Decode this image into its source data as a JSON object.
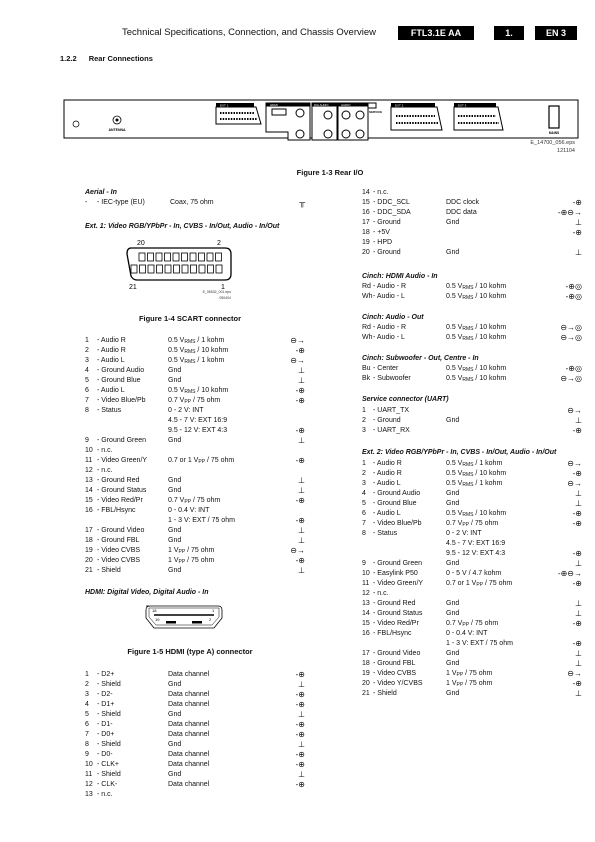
{
  "header": {
    "title": "Technical Specifications, Connection, and Chassis Overview",
    "model": "FTL3.1E AA",
    "chapter": "1.",
    "page": "EN 3"
  },
  "section": {
    "number": "1.2.2",
    "title": "Rear Connections"
  },
  "rear_panel": {
    "labels": {
      "antenna": "ANTENNA",
      "ext1": "EXT 1",
      "hdmi": "HDMI",
      "digital_audio": "DIG AUDIO",
      "audio": "AUDIO",
      "service": "SERVICE",
      "ext2": "EXT 2",
      "ext3": "EXT 3",
      "mains": "MAINS"
    },
    "file": "E_14700_056.eps",
    "date": "121104",
    "caption": "Figure 1-3 Rear I/O"
  },
  "icons": {
    "in": "in-arrow-icon",
    "out": "out-arrow-icon",
    "gnd": "ground-icon",
    "inout": "in-out-icon",
    "in-cinch": "in-cinch-icon",
    "out-cinch": "out-cinch-icon"
  },
  "aerial": {
    "heading": "Aerial - In",
    "rows": [
      {
        "n": "-",
        "name": "- IEC-type (EU)",
        "value": "Coax, 75 ohm",
        "icon": "aerial"
      }
    ]
  },
  "ext1": {
    "heading": "Ext. 1: Video RGB/YPbPr - In, CVBS - In/Out, Audio - In/Out",
    "figure": {
      "pin_tl": "20",
      "pin_tr": "2",
      "pin_bl": "21",
      "pin_br": "1",
      "file": "E_06532_001.eps",
      "date": "050404",
      "caption": "Figure 1-4 SCART connector"
    },
    "rows": [
      {
        "n": "1",
        "name": "- Audio R",
        "value": [
          "0.5 V",
          "RMS",
          " / 1 kohm"
        ],
        "icon": "out"
      },
      {
        "n": "2",
        "name": "- Audio R",
        "value": [
          "0.5 V",
          "RMS",
          " / 10 kohm"
        ],
        "icon": "in"
      },
      {
        "n": "3",
        "name": "- Audio L",
        "value": [
          "0.5 V",
          "RMS",
          " / 1 kohm"
        ],
        "icon": "out"
      },
      {
        "n": "4",
        "name": "- Ground Audio",
        "value": "Gnd",
        "icon": "gnd"
      },
      {
        "n": "5",
        "name": "- Ground Blue",
        "value": "Gnd",
        "icon": "gnd"
      },
      {
        "n": "6",
        "name": "- Audio L",
        "value": [
          "0.5 V",
          "RMS",
          " / 10 kohm"
        ],
        "icon": "in"
      },
      {
        "n": "7",
        "name": "- Video Blue/Pb",
        "value": [
          "0.7 V",
          "PP",
          " / 75 ohm"
        ],
        "icon": "in"
      },
      {
        "n": "8",
        "name": "- Status",
        "value": "0 - 2 V: INT",
        "icon": ""
      },
      {
        "n": "",
        "name": "",
        "value": "4.5 - 7 V: EXT 16:9",
        "icon": ""
      },
      {
        "n": "",
        "name": "",
        "value": "9.5 - 12 V: EXT 4:3",
        "icon": "in"
      },
      {
        "n": "9",
        "name": "- Ground Green",
        "value": "Gnd",
        "icon": "gnd"
      },
      {
        "n": "10",
        "name": "- n.c.",
        "value": "",
        "icon": ""
      },
      {
        "n": "11",
        "name": "- Video Green/Y",
        "value": [
          "0.7 or 1 V",
          "PP",
          " / 75 ohm"
        ],
        "icon": "in"
      },
      {
        "n": "12",
        "name": "- n.c.",
        "value": "",
        "icon": ""
      },
      {
        "n": "13",
        "name": "- Ground Red",
        "value": "Gnd",
        "icon": "gnd"
      },
      {
        "n": "14",
        "name": "- Ground Status",
        "value": "Gnd",
        "icon": "gnd"
      },
      {
        "n": "15",
        "name": "- Video Red/Pr",
        "value": [
          "0.7 V",
          "PP",
          " / 75 ohm"
        ],
        "icon": "in"
      },
      {
        "n": "16",
        "name": "- FBL/Hsync",
        "value": "0 - 0.4 V: INT",
        "icon": ""
      },
      {
        "n": "",
        "name": "",
        "value": "1 - 3 V: EXT / 75 ohm",
        "icon": "in"
      },
      {
        "n": "17",
        "name": "- Ground Video",
        "value": "Gnd",
        "icon": "gnd"
      },
      {
        "n": "18",
        "name": "- Ground FBL",
        "value": "Gnd",
        "icon": "gnd"
      },
      {
        "n": "19",
        "name": "- Video CVBS",
        "value": [
          "1 V",
          "PP",
          " / 75 ohm"
        ],
        "icon": "out"
      },
      {
        "n": "20",
        "name": "- Video CVBS",
        "value": [
          "1 V",
          "PP",
          " / 75 ohm"
        ],
        "icon": "in"
      },
      {
        "n": "21",
        "name": "- Shield",
        "value": "Gnd",
        "icon": "gnd"
      }
    ]
  },
  "hdmi": {
    "heading": "HDMI: Digital Video, Digital Audio - In",
    "figure": {
      "pin_tl": "18",
      "pin_tr": "1",
      "pin_bl": "19",
      "pin_br": "2",
      "caption": "Figure 1-5 HDMI (type A) connector"
    },
    "rows": [
      {
        "n": "1",
        "name": "- D2+",
        "value": "Data channel",
        "icon": "in"
      },
      {
        "n": "2",
        "name": "- Shield",
        "value": "Gnd",
        "icon": "gnd"
      },
      {
        "n": "3",
        "name": "- D2-",
        "value": "Data channel",
        "icon": "in"
      },
      {
        "n": "4",
        "name": "- D1+",
        "value": "Data channel",
        "icon": "in"
      },
      {
        "n": "5",
        "name": "- Shield",
        "value": "Gnd",
        "icon": "gnd"
      },
      {
        "n": "6",
        "name": "- D1-",
        "value": "Data channel",
        "icon": "in"
      },
      {
        "n": "7",
        "name": "- D0+",
        "value": "Data channel",
        "icon": "in"
      },
      {
        "n": "8",
        "name": "- Shield",
        "value": "Gnd",
        "icon": "gnd"
      },
      {
        "n": "9",
        "name": "- D0-",
        "value": "Data channel",
        "icon": "in"
      },
      {
        "n": "10",
        "name": "- CLK+",
        "value": "Data channel",
        "icon": "in"
      },
      {
        "n": "11",
        "name": "- Shield",
        "value": "Gnd",
        "icon": "gnd"
      },
      {
        "n": "12",
        "name": "- CLK-",
        "value": "Data channel",
        "icon": "in"
      },
      {
        "n": "13",
        "name": "- n.c.",
        "value": "",
        "icon": ""
      }
    ],
    "rows_cont": [
      {
        "n": "14",
        "name": "- n.c.",
        "value": "",
        "icon": ""
      },
      {
        "n": "15",
        "name": "- DDC_SCL",
        "value": "DDC clock",
        "icon": "in"
      },
      {
        "n": "16",
        "name": "- DDC_SDA",
        "value": "DDC data",
        "icon": "inout"
      },
      {
        "n": "17",
        "name": "- Ground",
        "value": "Gnd",
        "icon": "gnd"
      },
      {
        "n": "18",
        "name": "- +5V",
        "value": "",
        "icon": "in"
      },
      {
        "n": "19",
        "name": "- HPD",
        "value": "",
        "icon": ""
      },
      {
        "n": "20",
        "name": "- Ground",
        "value": "Gnd",
        "icon": "gnd"
      }
    ]
  },
  "cinch_hdmi_audio": {
    "heading": "Cinch: HDMI Audio - In",
    "rows": [
      {
        "n": "Rd",
        "name": "- Audio - R",
        "value": [
          "0.5 V",
          "RMS",
          " / 10 kohm"
        ],
        "icon": "in-cinch"
      },
      {
        "n": "Wh",
        "name": "- Audio - L",
        "value": [
          "0.5 V",
          "RMS",
          " / 10 kohm"
        ],
        "icon": "in-cinch"
      }
    ]
  },
  "cinch_audio_out": {
    "heading": "Cinch: Audio - Out",
    "rows": [
      {
        "n": "Rd",
        "name": "- Audio - R",
        "value": [
          "0.5 V",
          "RMS",
          " / 10 kohm"
        ],
        "icon": "out-cinch"
      },
      {
        "n": "Wh",
        "name": "- Audio - L",
        "value": [
          "0.5 V",
          "RMS",
          " / 10 kohm"
        ],
        "icon": "out-cinch"
      }
    ]
  },
  "cinch_sub": {
    "heading": "Cinch: Subwoofer - Out, Centre - In",
    "rows": [
      {
        "n": "Bu",
        "name": "- Center",
        "value": [
          "0.5 V",
          "RMS",
          " / 10 kohm"
        ],
        "icon": "in-cinch"
      },
      {
        "n": "Bk",
        "name": "- Subwoofer",
        "value": [
          "0.5 V",
          "RMS",
          " / 10 kohm"
        ],
        "icon": "out-cinch"
      }
    ]
  },
  "service": {
    "heading": "Service connector (UART)",
    "rows": [
      {
        "n": "1",
        "name": "- UART_TX",
        "value": "",
        "icon": "out"
      },
      {
        "n": "2",
        "name": "- Ground",
        "value": "Gnd",
        "icon": "gnd"
      },
      {
        "n": "3",
        "name": "- UART_RX",
        "value": "",
        "icon": "in"
      }
    ]
  },
  "ext2": {
    "heading": "Ext. 2: Video RGB/YPbPr - In, CVBS - In/Out, Audio - In/Out",
    "rows": [
      {
        "n": "1",
        "name": "- Audio R",
        "value": [
          "0.5 V",
          "RMS",
          " / 1 kohm"
        ],
        "icon": "out"
      },
      {
        "n": "2",
        "name": "- Audio R",
        "value": [
          "0.5 V",
          "RMS",
          " / 10 kohm"
        ],
        "icon": "in"
      },
      {
        "n": "3",
        "name": "- Audio L",
        "value": [
          "0.5 V",
          "RMS",
          " / 1 kohm"
        ],
        "icon": "out"
      },
      {
        "n": "4",
        "name": "- Ground Audio",
        "value": "Gnd",
        "icon": "gnd"
      },
      {
        "n": "5",
        "name": "- Ground Blue",
        "value": "Gnd",
        "icon": "gnd"
      },
      {
        "n": "6",
        "name": "- Audio L",
        "value": [
          "0.5 V",
          "RMS",
          " / 10 kohm"
        ],
        "icon": "in"
      },
      {
        "n": "7",
        "name": "- Video Blue/Pb",
        "value": [
          "0.7 V",
          "PP",
          " / 75 ohm"
        ],
        "icon": "in"
      },
      {
        "n": "8",
        "name": "- Status",
        "value": "0 - 2 V: INT",
        "icon": ""
      },
      {
        "n": "",
        "name": "",
        "value": "4.5 - 7 V: EXT 16:9",
        "icon": ""
      },
      {
        "n": "",
        "name": "",
        "value": "9.5 - 12 V: EXT 4:3",
        "icon": "in"
      },
      {
        "n": "9",
        "name": "- Ground Green",
        "value": "Gnd",
        "icon": "gnd"
      },
      {
        "n": "10",
        "name": "- Easylink P50",
        "value": "0 - 5 V / 4.7 kohm",
        "icon": "inout"
      },
      {
        "n": "11",
        "name": "- Video Green/Y",
        "value": [
          "0.7 or 1 V",
          "PP",
          " / 75 ohm"
        ],
        "icon": "in"
      },
      {
        "n": "12",
        "name": "- n.c.",
        "value": "",
        "icon": ""
      },
      {
        "n": "13",
        "name": "- Ground Red",
        "value": "Gnd",
        "icon": "gnd"
      },
      {
        "n": "14",
        "name": "- Ground Status",
        "value": "Gnd",
        "icon": "gnd"
      },
      {
        "n": "15",
        "name": "- Video Red/Pr",
        "value": [
          "0.7 V",
          "PP",
          " / 75 ohm"
        ],
        "icon": "in"
      },
      {
        "n": "16",
        "name": "- FBL/Hsync",
        "value": "0 - 0.4 V: INT",
        "icon": ""
      },
      {
        "n": "",
        "name": "",
        "value": "1 - 3 V: EXT / 75 ohm",
        "icon": "in"
      },
      {
        "n": "17",
        "name": "- Ground Video",
        "value": "Gnd",
        "icon": "gnd"
      },
      {
        "n": "18",
        "name": "- Ground FBL",
        "value": "Gnd",
        "icon": "gnd"
      },
      {
        "n": "19",
        "name": "- Video CVBS",
        "value": [
          "1 V",
          "PP",
          " / 75 ohm"
        ],
        "icon": "out"
      },
      {
        "n": "20",
        "name": "- Video Y/CVBS",
        "value": [
          "1 V",
          "PP",
          " / 75 ohm"
        ],
        "icon": "in"
      },
      {
        "n": "21",
        "name": "- Shield",
        "value": "Gnd",
        "icon": "gnd"
      }
    ]
  }
}
